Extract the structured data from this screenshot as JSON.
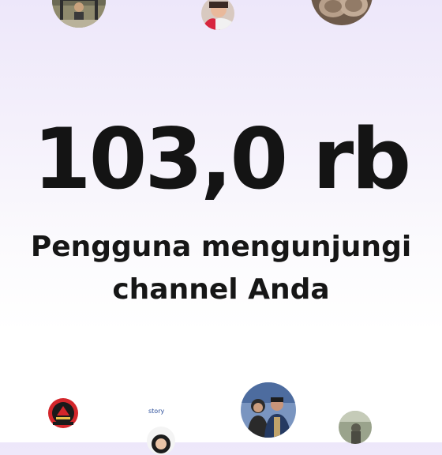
{
  "stat": {
    "value": "103,0 rb",
    "caption_line1": "Pengguna mengunjungi",
    "caption_line2": "channel Anda"
  },
  "avatars": [
    {
      "name": "gym-photo"
    },
    {
      "name": "child-photo"
    },
    {
      "name": "sandals-photo"
    },
    {
      "name": "emblem-logo"
    },
    {
      "name": "story-person-photo",
      "text": "story"
    },
    {
      "name": "couple-photo"
    },
    {
      "name": "outdoor-photo"
    }
  ],
  "colors": {
    "text": "#141414",
    "background_top": "#ede7fa",
    "background_bottom": "#ffffff"
  }
}
